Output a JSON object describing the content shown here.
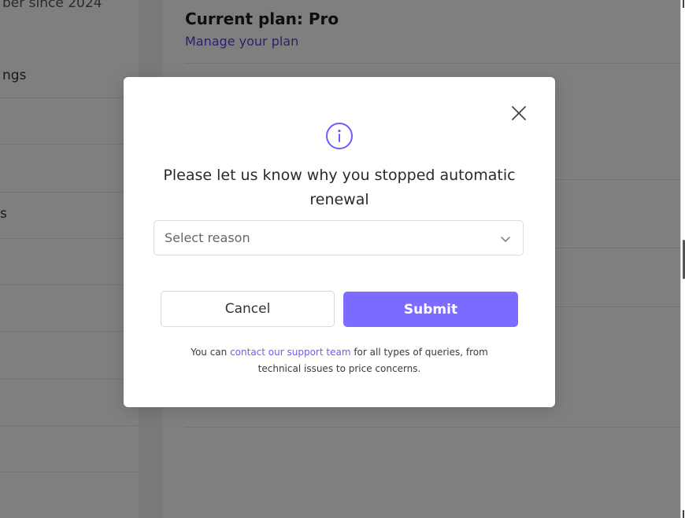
{
  "sidebar": {
    "items": [
      {
        "label": "ber since 2024"
      },
      {
        "label": "ngs"
      },
      {
        "label": ""
      },
      {
        "label": ""
      },
      {
        "label": "s"
      },
      {
        "label": ""
      },
      {
        "label": ""
      },
      {
        "label": ""
      },
      {
        "label": ""
      }
    ]
  },
  "main": {
    "plan_title": "Current plan: Pro",
    "manage_link": "Manage your plan"
  },
  "modal": {
    "close_icon": "close-icon",
    "info_icon": "info-icon",
    "title": "Please let us know why you stopped automatic renewal",
    "select": {
      "placeholder": "Select reason",
      "chevron_icon": "chevron-down-icon"
    },
    "cancel_label": "Cancel",
    "submit_label": "Submit",
    "help": {
      "prefix": "You can ",
      "link": "contact our support team",
      "suffix": " for all types of queries, from technical issues to price concerns."
    }
  },
  "colors": {
    "accent": "#7b6cff",
    "link": "#5b40d6",
    "overlay": "rgba(0,0,0,0.5)"
  }
}
